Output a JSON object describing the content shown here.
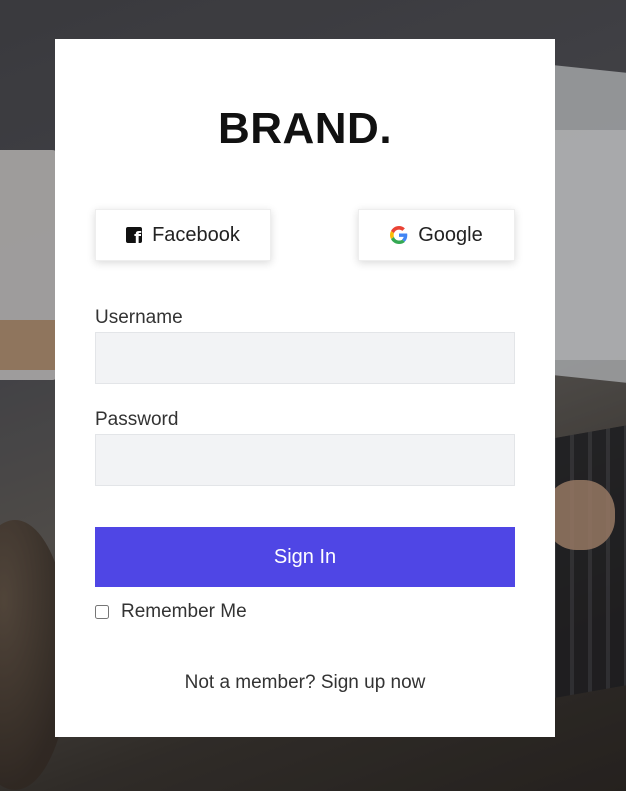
{
  "brand": {
    "name": "BRAND."
  },
  "social": {
    "facebook_label": "Facebook",
    "facebook_icon": "facebook-icon",
    "google_label": "Google",
    "google_icon": "google-icon",
    "google_colors": [
      "#4285F4",
      "#EA4335",
      "#FBBC05",
      "#34A853"
    ]
  },
  "form": {
    "username_label": "Username",
    "username_value": "",
    "password_label": "Password",
    "password_value": "",
    "signin_label": "Sign In",
    "remember_label": "Remember Me",
    "remember_checked": false
  },
  "footer": {
    "prompt": "Not a member?",
    "signup_link": "Sign up now"
  },
  "colors": {
    "accent": "#4f46e5",
    "card": "#ffffff",
    "input_bg": "#f2f3f5"
  }
}
